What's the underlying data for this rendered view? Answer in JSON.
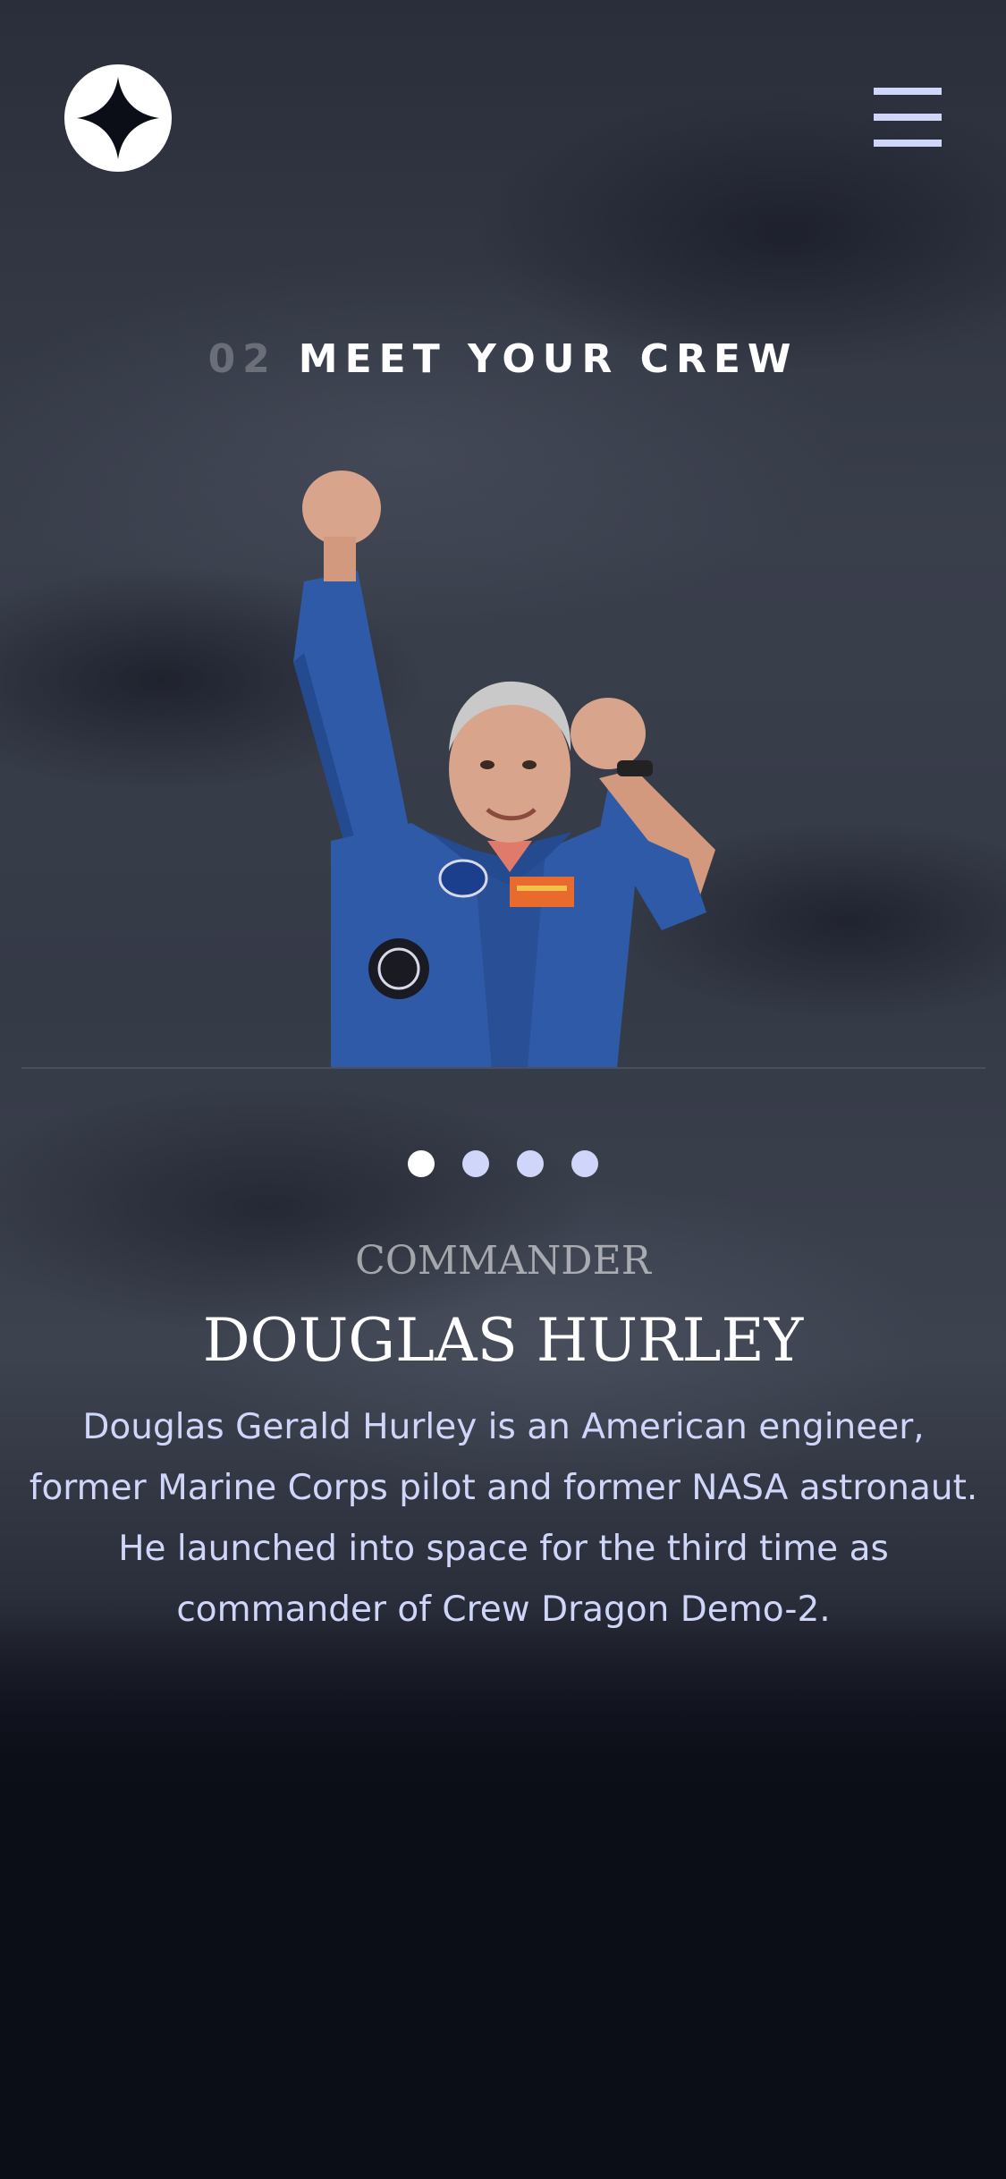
{
  "header": {
    "logo": "star-logo",
    "menu_icon": "hamburger-menu-icon"
  },
  "section": {
    "number": "02",
    "title": "MEET YOUR CREW"
  },
  "crew": {
    "image_alt": "Douglas Hurley",
    "role": "COMMANDER",
    "name": "DOUGLAS HURLEY",
    "bio": "Douglas Gerald Hurley is an American engineer, former Marine Corps pilot and former NASA astronaut. He launched into space for the third time as commander of Crew Dragon Demo-2."
  },
  "slider": {
    "count": 4,
    "active_index": 0
  },
  "colors": {
    "background": "#0b0d17",
    "accent": "#d0d6f9",
    "white": "#ffffff"
  }
}
